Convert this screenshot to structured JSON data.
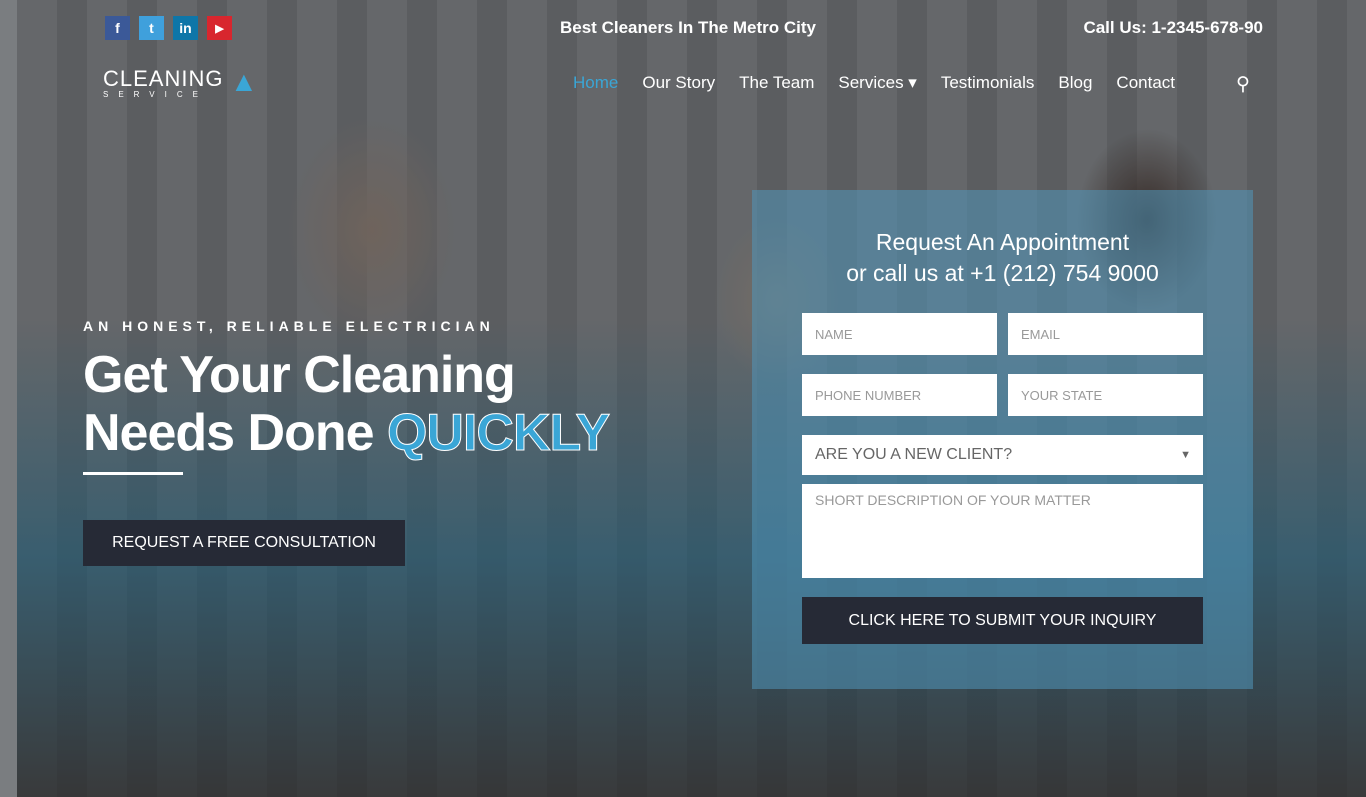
{
  "social": [
    {
      "name": "facebook",
      "glyph": "f",
      "color": "#3b5998"
    },
    {
      "name": "twitter",
      "glyph": "t",
      "color": "#3fa0dc"
    },
    {
      "name": "linkedin",
      "glyph": "in",
      "color": "#0e76a8"
    },
    {
      "name": "youtube",
      "glyph": "▶",
      "color": "#d8262e"
    }
  ],
  "topbar": {
    "tagline": "Best Cleaners In The Metro City",
    "call": "Call Us: 1-2345-678-90"
  },
  "logo": {
    "main": "CLEANING",
    "sub": "SERVICE"
  },
  "nav": [
    "Home",
    "Our Story",
    "The Team",
    "Services ▾",
    "Testimonials",
    "Blog",
    "Contact"
  ],
  "hero": {
    "kicker": "AN HONEST, RELIABLE ELECTRICIAN",
    "line1": "Get Your Cleaning",
    "line2": "Needs Done ",
    "highlight": "QUICKLY",
    "cta": "REQUEST A FREE CONSULTATION"
  },
  "form": {
    "title1": "Request An Appointment",
    "title2": "or call us at +1 (212) 754 9000",
    "name": "NAME",
    "email": "EMAIL",
    "phone": "PHONE NUMBER",
    "state": "YOUR STATE",
    "client": "ARE YOU A NEW CLIENT?",
    "desc": "SHORT DESCRIPTION OF YOUR MATTER",
    "submit": "CLICK HERE TO SUBMIT YOUR INQUIRY"
  },
  "colors": {
    "accent": "#3aa6d6",
    "dark": "#262a36"
  }
}
